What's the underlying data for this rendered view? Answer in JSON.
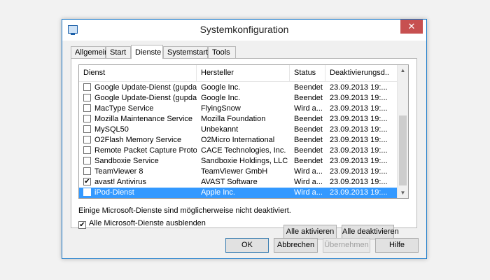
{
  "window": {
    "title": "Systemkonfiguration",
    "close_label": "✕"
  },
  "tabs": [
    {
      "label": "Allgemein"
    },
    {
      "label": "Start"
    },
    {
      "label": "Dienste"
    },
    {
      "label": "Systemstart"
    },
    {
      "label": "Tools"
    }
  ],
  "services": {
    "columns": [
      "Dienst",
      "Hersteller",
      "Status",
      "Deaktivierungsd..."
    ],
    "rows": [
      {
        "name": "Google Update-Dienst (gupdate)",
        "vendor": "Google Inc.",
        "status": "Beendet",
        "date": "23.09.2013 19:...",
        "checked": false
      },
      {
        "name": "Google Update-Dienst (gupdatem)",
        "vendor": "Google Inc.",
        "status": "Beendet",
        "date": "23.09.2013 19:...",
        "checked": false
      },
      {
        "name": "MacType Service",
        "vendor": "FlyingSnow",
        "status": "Wird a...",
        "date": "23.09.2013 19:...",
        "checked": false
      },
      {
        "name": "Mozilla Maintenance Service",
        "vendor": "Mozilla Foundation",
        "status": "Beendet",
        "date": "23.09.2013 19:...",
        "checked": false
      },
      {
        "name": "MySQL50",
        "vendor": "Unbekannt",
        "status": "Beendet",
        "date": "23.09.2013 19:...",
        "checked": false
      },
      {
        "name": "O2Flash Memory Service",
        "vendor": "O2Micro International",
        "status": "Beendet",
        "date": "23.09.2013 19:...",
        "checked": false
      },
      {
        "name": "Remote Packet Capture Protocol...",
        "vendor": "CACE Technologies, Inc.",
        "status": "Beendet",
        "date": "23.09.2013 19:...",
        "checked": false
      },
      {
        "name": "Sandboxie Service",
        "vendor": "Sandboxie Holdings, LLC",
        "status": "Beendet",
        "date": "23.09.2013 19:...",
        "checked": false
      },
      {
        "name": "TeamViewer 8",
        "vendor": "TeamViewer GmbH",
        "status": "Wird a...",
        "date": "23.09.2013 19:...",
        "checked": false
      },
      {
        "name": "avast! Antivirus",
        "vendor": "AVAST Software",
        "status": "Wird a...",
        "date": "23.09.2013 19:...",
        "checked": true
      },
      {
        "name": "iPod-Dienst",
        "vendor": "Apple Inc.",
        "status": "Wird a...",
        "date": "23.09.2013 19:...",
        "checked": false,
        "selected": true
      }
    ]
  },
  "note": "Einige Microsoft-Dienste sind möglicherweise nicht deaktiviert.",
  "buttons": {
    "enable_all": "Alle aktivieren",
    "disable_all": "Alle deaktivieren",
    "ok": "OK",
    "cancel": "Abbrechen",
    "apply": "Übernehmen",
    "help": "Hilfe"
  },
  "hide_microsoft": {
    "label": "Alle Microsoft-Dienste ausblenden",
    "checked": true
  },
  "icons": {
    "check": "✔",
    "scroll_up": "▲",
    "scroll_down": "▼"
  },
  "colors": {
    "selection": "#3399ff",
    "close": "#c75050",
    "window_border": "#1979ca"
  }
}
